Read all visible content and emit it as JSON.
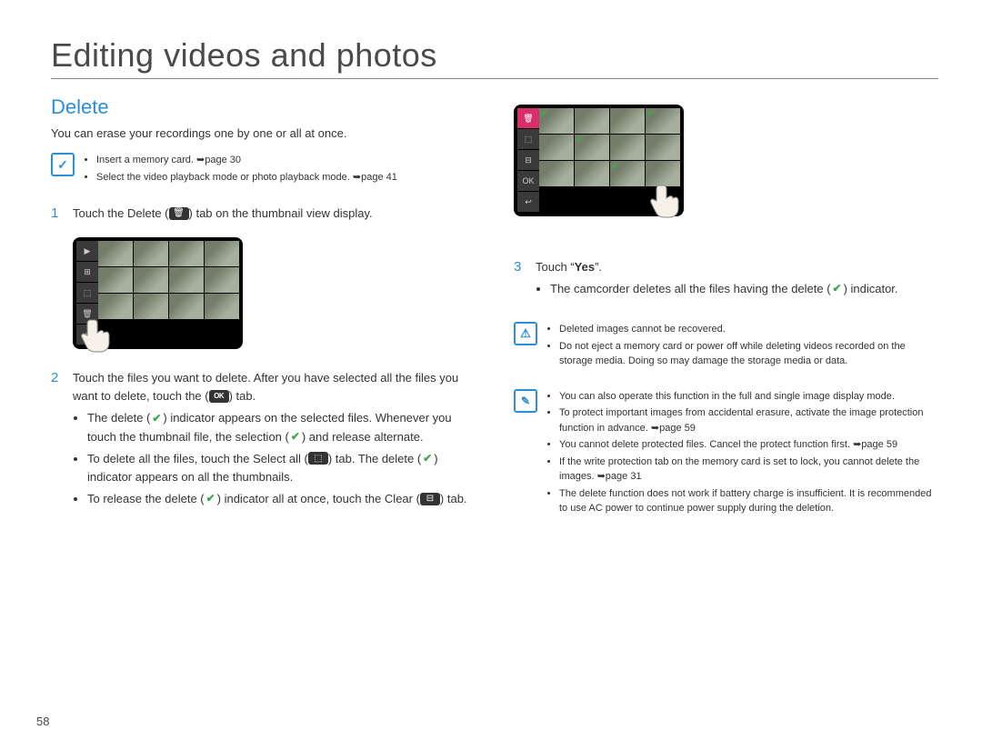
{
  "page_number": "58",
  "chapter_title": "Editing videos and photos",
  "section_title": "Delete",
  "intro": "You can erase your recordings one by one or all at once.",
  "prereq": {
    "items": [
      {
        "text": "Insert a memory card. ",
        "ref": "page 30"
      },
      {
        "text": "Select the video playback mode or photo playback mode. ",
        "ref": "page 41"
      }
    ]
  },
  "steps": {
    "s1": {
      "num": "1",
      "text_a": "Touch the Delete (",
      "text_b": ") tab on the thumbnail view display."
    },
    "s2": {
      "num": "2",
      "lead_a": "Touch the files you want to delete. After you have selected all the files you want to delete, touch the (",
      "lead_b": ") tab.",
      "b1_a": "The delete (",
      "b1_b": ") indicator appears on the selected files. Whenever you touch the thumbnail file, the selection (",
      "b1_c": ") and release alternate.",
      "b2_a": "To delete all the files, touch the Select all (",
      "b2_b": ") tab. The delete (",
      "b2_c": ") indicator appears on all the thumbnails.",
      "b3_a": "To release the delete (",
      "b3_b": ") indicator all at once, touch the Clear (",
      "b3_c": ") tab."
    },
    "s3": {
      "num": "3",
      "lead_a": "Touch “",
      "lead_yes": "Yes",
      "lead_b": "”.",
      "b1_a": "The camcorder deletes all the files having the delete (",
      "b1_b": ") indicator."
    }
  },
  "warning": {
    "items": [
      "Deleted images cannot be recovered.",
      "Do not eject a memory card or power off while deleting videos recorded on the storage media. Doing so may damage the storage media or data."
    ]
  },
  "notes": {
    "items": [
      {
        "text": "You can also operate this function in the full and single image display mode."
      },
      {
        "text": "To protect important images from accidental erasure, activate the image protection function in advance. ",
        "ref": "page 59"
      },
      {
        "text": "You cannot delete protected files. Cancel the protect function first. ",
        "ref": "page 59"
      },
      {
        "text": "If the write protection tab on the memory card is set to lock, you cannot delete the images. ",
        "ref": "page 31"
      },
      {
        "text": "The delete function does not work if battery charge is insufficient. It is recommended to use AC power to continue power supply during the deletion."
      }
    ]
  },
  "fig1": {
    "side_labels": [
      "▶",
      "⊞",
      "⬚",
      "🗑",
      "⏎"
    ],
    "active_index": 3
  },
  "fig2": {
    "side_labels": [
      "🗑",
      "⬚",
      "⊟",
      "OK",
      "↩"
    ],
    "active_index": 0,
    "checked_cells": [
      0,
      3,
      5,
      10
    ]
  }
}
